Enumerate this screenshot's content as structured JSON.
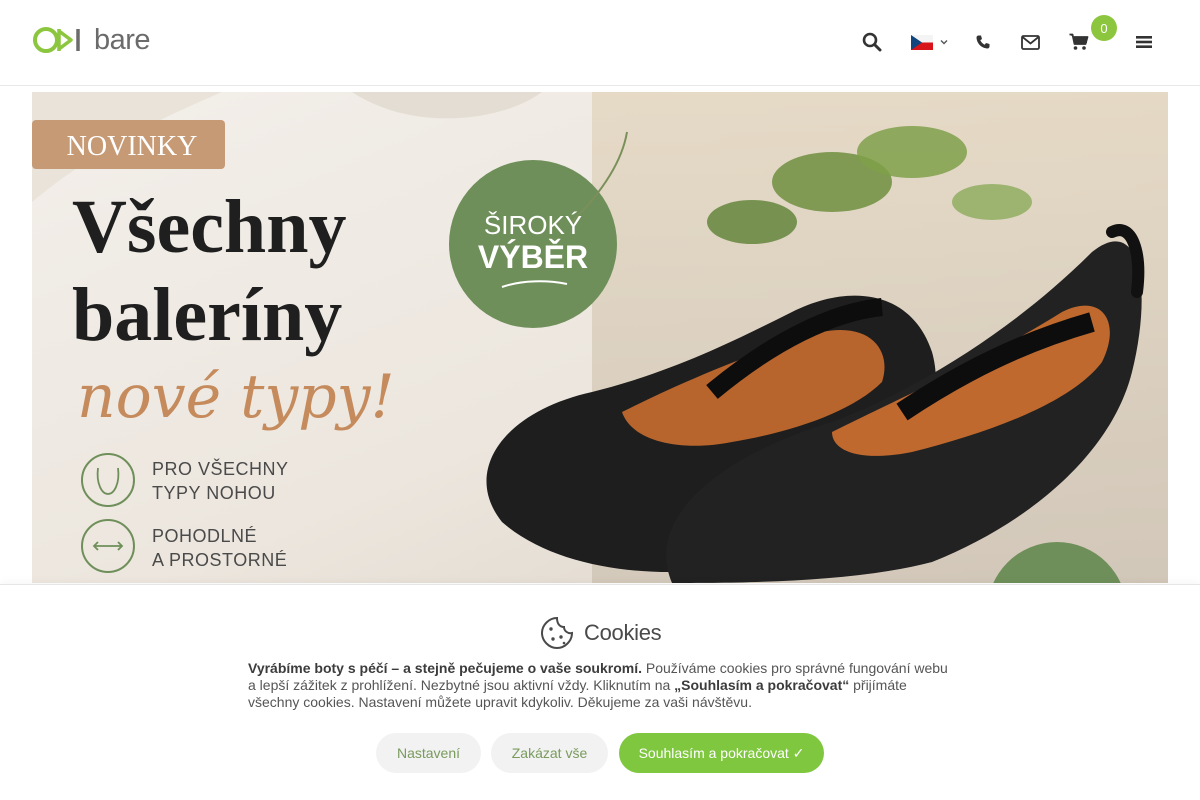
{
  "header": {
    "logo_text": "bare",
    "icons": [
      "search-icon",
      "flag-cz-icon",
      "chevron-down-icon",
      "phone-icon",
      "envelope-icon",
      "cart-icon",
      "menu-icon"
    ],
    "cart_count": "0"
  },
  "banner": {
    "badge": "NOVINKY",
    "headline_1": "Všechny",
    "headline_2": "baleríny",
    "headline_script": "nové typy!",
    "circle_line_1": "ŠIROKÝ",
    "circle_line_2": "VÝBĚR",
    "feature_1_line_1": "PRO VŠECHNY",
    "feature_1_line_2": "TYPY NOHOU",
    "feature_2_line_1": "POHODLNÉ",
    "feature_2_line_2": "A PROSTORNÉ"
  },
  "cookies": {
    "title": "Cookies",
    "text_bold_1": "Vyrábíme boty s péčí – a stejně pečujeme o vaše soukromí.",
    "text_1": " Používáme cookies pro správné fungování webu a lepší zážitek z prohlížení. Nezbytné jsou aktivní vždy. Kliknutím na ",
    "text_bold_2": "„Souhlasím a pokračovat“",
    "text_2": " přijímáte všechny cookies. Nastavení můžete upravit kdykoliv. Děkujeme za vaši návštěvu.",
    "settings_label": "Nastavení",
    "deny_label": "Zakázat vše",
    "accept_label": "Souhlasím a pokračovat ✓"
  },
  "colors": {
    "brand_green": "#8cc63f",
    "accept_green": "#7fc73f",
    "badge_tan": "#c79a76",
    "circle_green": "#6f8f5a"
  }
}
